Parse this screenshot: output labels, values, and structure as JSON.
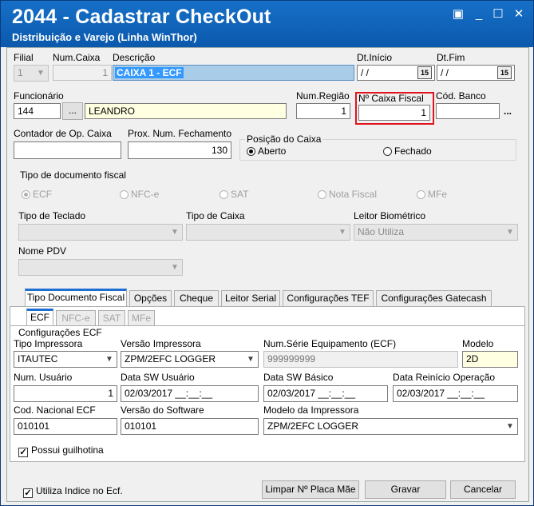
{
  "window": {
    "title": "2044 - Cadastrar CheckOut",
    "subtitle": "Distribuição e Varejo (Linha WinThor)",
    "controls": {
      "restore": "▣",
      "minimize": "_",
      "maximize": "☐",
      "close": "✕"
    }
  },
  "header": {
    "filial": {
      "label": "Filial",
      "value": "1"
    },
    "num_caixa": {
      "label": "Num.Caixa",
      "value": "1"
    },
    "descricao": {
      "label": "Descrição",
      "value": "CAIXA 1 - ECF"
    },
    "dt_inicio": {
      "label": "Dt.Início",
      "value": " / /",
      "button": "15"
    },
    "dt_fim": {
      "label": "Dt.Fim",
      "value": " / /",
      "button": "15"
    },
    "funcionario": {
      "label": "Funcionário",
      "code": "144",
      "lookup": "...",
      "name": "LEANDRO"
    },
    "num_regiao": {
      "label": "Num.Região",
      "value": "1"
    },
    "n_caixa_fiscal": {
      "label": "Nº Caixa Fiscal",
      "value": "1"
    },
    "cod_banco": {
      "label": "Cód. Banco",
      "value": "",
      "lookup": "..."
    },
    "contador_op": {
      "label": "Contador de Op. Caixa",
      "value": ""
    },
    "prox_num_fechamento": {
      "label": "Prox. Num. Fechamento",
      "value": "130"
    },
    "posicao_caixa": {
      "label": "Posição do Caixa",
      "aberto": "Aberto",
      "fechado": "Fechado"
    }
  },
  "tipo_documento": {
    "label": "Tipo de documento fiscal",
    "options": [
      "ECF",
      "NFC-e",
      "SAT",
      "Nota Fiscal",
      "MFe"
    ]
  },
  "selects": {
    "tipo_teclado": {
      "label": "Tipo de Teclado",
      "value": ""
    },
    "tipo_caixa": {
      "label": "Tipo de Caixa",
      "value": ""
    },
    "leitor_biometrico": {
      "label": "Leitor Biométrico",
      "value": "Não Utiliza"
    },
    "nome_pdv": {
      "label": "Nome PDV",
      "value": ""
    }
  },
  "tabs": [
    "Tipo Documento Fiscal",
    "Opções",
    "Cheque",
    "Leitor Serial",
    "Configurações TEF",
    "Configurações Gatecash"
  ],
  "subtabs": [
    "ECF",
    "NFC-e",
    "SAT",
    "MFe"
  ],
  "ecf": {
    "group_label": "Configurações ECF",
    "tipo_impressora": {
      "label": "Tipo Impressora",
      "value": "ITAUTEC"
    },
    "versao_impressora": {
      "label": "Versão Impressora",
      "value": "ZPM/2EFC LOGGER"
    },
    "num_serie": {
      "label": "Num.Série Equipamento (ECF)",
      "value": "999999999"
    },
    "modelo": {
      "label": "Modelo",
      "value": "2D"
    },
    "num_usuario": {
      "label": "Num. Usuário",
      "value": "1"
    },
    "data_sw_usuario": {
      "label": "Data  SW Usuário",
      "value": "02/03/2017 __:__:__"
    },
    "data_sw_basico": {
      "label": "Data SW Básico",
      "value": "02/03/2017 __:__:__"
    },
    "data_reinicio": {
      "label": "Data Reinício Operação",
      "value": "02/03/2017 __:__:__"
    },
    "cod_nacional": {
      "label": "Cod. Nacional ECF",
      "value": "010101"
    },
    "versao_software": {
      "label": "Versão do Software",
      "value": "010101"
    },
    "modelo_impressora": {
      "label": "Modelo da Impressora",
      "value": "ZPM/2EFC LOGGER"
    },
    "possui_guilhotina": {
      "label": "Possui guilhotina",
      "checked": true
    }
  },
  "footer": {
    "utiliza_indice": {
      "label": "Utiliza Indice no Ecf.",
      "checked": true
    },
    "limpar": "Limpar Nº Placa Mãe",
    "gravar": "Gravar",
    "cancelar": "Cancelar"
  },
  "colors": {
    "title_bar": "#0b59ad",
    "highlight": "#e0141e",
    "selection": "#3399ff",
    "tab_accent": "#1e6fcf"
  }
}
